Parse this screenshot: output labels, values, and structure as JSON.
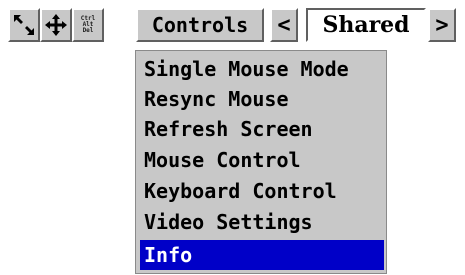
{
  "toolbar": {
    "icons": [
      "corner-arrows-icon",
      "move-icon",
      "ctrl-alt-del-icon"
    ],
    "ctrl_alt_del": [
      "Ctrl",
      "Alt",
      "Del"
    ],
    "controls_label": "Controls",
    "prev_label": "<",
    "mode_value": "Shared",
    "next_label": ">"
  },
  "menu": {
    "items": [
      {
        "label": "Single Mouse Mode"
      },
      {
        "label": "Resync Mouse"
      },
      {
        "label": "Refresh Screen"
      },
      {
        "label": "Mouse Control"
      },
      {
        "label": "Keyboard Control"
      },
      {
        "label": "Video Settings"
      },
      {
        "label": "Info",
        "selected": true
      }
    ]
  },
  "colors": {
    "button_face": "#c8c8c8",
    "selection": "#0000c8",
    "selection_text": "#ffffff",
    "field_bg": "#ffffff"
  }
}
